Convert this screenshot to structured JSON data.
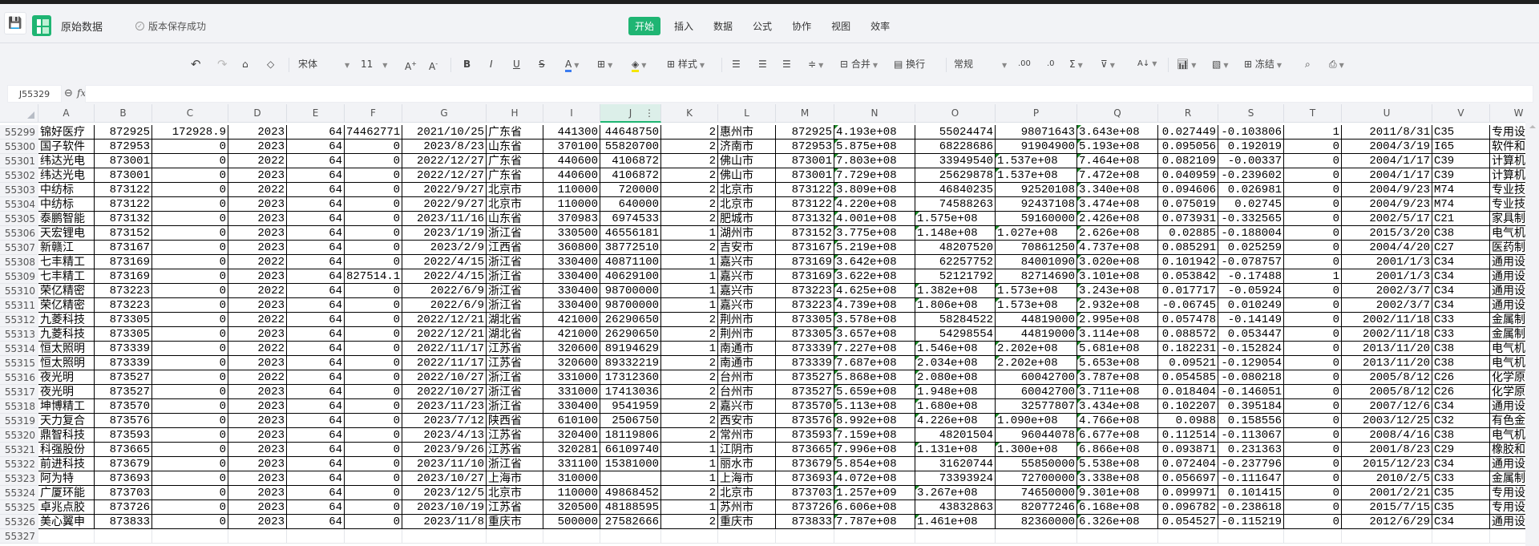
{
  "app": {
    "doc_title": "原始数据",
    "save_status": "版本保存成功",
    "brand_color": "#1fb573"
  },
  "menu_tabs": [
    {
      "label": "开始",
      "active": true
    },
    {
      "label": "插入",
      "active": false
    },
    {
      "label": "数据",
      "active": false
    },
    {
      "label": "公式",
      "active": false
    },
    {
      "label": "协作",
      "active": false
    },
    {
      "label": "视图",
      "active": false
    },
    {
      "label": "效率",
      "active": false
    }
  ],
  "toolbar": {
    "font_name": "宋体",
    "font_size": "11",
    "style_label": "样式",
    "merge_label": "合并",
    "wrap_label": "换行",
    "number_format": "常规",
    "freeze_label": "冻结",
    "font_color": "#3b7cf0",
    "fill_color": "#f5e600"
  },
  "formula_bar": {
    "name_box": "J55329",
    "formula": ""
  },
  "sheet": {
    "selected_column": "J",
    "columns": [
      "A",
      "B",
      "C",
      "D",
      "E",
      "F",
      "G",
      "H",
      "I",
      "J",
      "K",
      "L",
      "M",
      "N",
      "O",
      "P",
      "Q",
      "R",
      "S",
      "T",
      "U",
      "V",
      "W"
    ],
    "row_numbers": [
      "55299",
      "55300",
      "55301",
      "55302",
      "55303",
      "55304",
      "55305",
      "55306",
      "55307",
      "55308",
      "55309",
      "55310",
      "55311",
      "55312",
      "55313",
      "55314",
      "55315",
      "55316",
      "55317",
      "55318",
      "55319",
      "55320",
      "55321",
      "55322",
      "55323",
      "55324",
      "55325",
      "55326",
      "55327"
    ],
    "rows": [
      [
        "锦好医疗",
        "872925",
        "172928.9",
        "2023",
        "64",
        "74462771",
        "2021/10/25",
        "广东省",
        "441300",
        "44648750",
        "2",
        "惠州市",
        "872925",
        "4.193e+08",
        "55024474",
        "98071643",
        "3.643e+08",
        "0.027449",
        "-0.103806",
        "1",
        "2011/8/31",
        "C35",
        "专用设"
      ],
      [
        "国子软件",
        "872953",
        "0",
        "2023",
        "64",
        "0",
        "2023/8/23",
        "山东省",
        "370100",
        "55820700",
        "2",
        "济南市",
        "872953",
        "5.875e+08",
        "68228686",
        "91904900",
        "5.193e+08",
        "0.095056",
        "0.192019",
        "0",
        "2004/3/19",
        "I65",
        "软件和"
      ],
      [
        "纬达光电",
        "873001",
        "0",
        "2022",
        "64",
        "0",
        "2022/12/27",
        "广东省",
        "440600",
        "4106872",
        "2",
        "佛山市",
        "873001",
        "7.803e+08",
        "33949540",
        "1.537e+08",
        "7.464e+08",
        "0.082109",
        "-0.00337",
        "0",
        "2004/1/17",
        "C39",
        "计算机"
      ],
      [
        "纬达光电",
        "873001",
        "0",
        "2023",
        "64",
        "0",
        "2022/12/27",
        "广东省",
        "440600",
        "4106872",
        "2",
        "佛山市",
        "873001",
        "7.729e+08",
        "25629878",
        "1.537e+08",
        "7.472e+08",
        "0.040959",
        "-0.239602",
        "0",
        "2004/1/17",
        "C39",
        "计算机"
      ],
      [
        "中纺标",
        "873122",
        "0",
        "2022",
        "64",
        "0",
        "2022/9/27",
        "北京市",
        "110000",
        "720000",
        "2",
        "北京市",
        "873122",
        "3.809e+08",
        "46840235",
        "92520108",
        "3.340e+08",
        "0.094606",
        "0.026981",
        "0",
        "2004/9/23",
        "M74",
        "专业技"
      ],
      [
        "中纺标",
        "873122",
        "0",
        "2023",
        "64",
        "0",
        "2022/9/27",
        "北京市",
        "110000",
        "640000",
        "2",
        "北京市",
        "873122",
        "4.220e+08",
        "74588263",
        "92437108",
        "3.474e+08",
        "0.075019",
        "0.02745",
        "0",
        "2004/9/23",
        "M74",
        "专业技"
      ],
      [
        "泰鹏智能",
        "873132",
        "0",
        "2023",
        "64",
        "0",
        "2023/11/16",
        "山东省",
        "370983",
        "6974533",
        "2",
        "肥城市",
        "873132",
        "4.001e+08",
        "1.575e+08",
        "59160000",
        "2.426e+08",
        "0.073931",
        "-0.332565",
        "0",
        "2002/5/17",
        "C21",
        "家具制"
      ],
      [
        "天宏锂电",
        "873152",
        "0",
        "2023",
        "64",
        "0",
        "2023/1/19",
        "浙江省",
        "330500",
        "46556181",
        "1",
        "湖州市",
        "873152",
        "3.775e+08",
        "1.148e+08",
        "1.027e+08",
        "2.626e+08",
        "0.02885",
        "-0.188004",
        "0",
        "2015/3/20",
        "C38",
        "电气机"
      ],
      [
        "新赣江",
        "873167",
        "0",
        "2023",
        "64",
        "0",
        "2023/2/9",
        "江西省",
        "360800",
        "38772510",
        "2",
        "吉安市",
        "873167",
        "5.219e+08",
        "48207520",
        "70861250",
        "4.737e+08",
        "0.085291",
        "0.025259",
        "0",
        "2004/4/20",
        "C27",
        "医药制"
      ],
      [
        "七丰精工",
        "873169",
        "0",
        "2022",
        "64",
        "0",
        "2022/4/15",
        "浙江省",
        "330400",
        "40871100",
        "1",
        "嘉兴市",
        "873169",
        "3.642e+08",
        "62257752",
        "84001090",
        "3.020e+08",
        "0.101942",
        "-0.078757",
        "0",
        "2001/1/3",
        "C34",
        "通用设"
      ],
      [
        "七丰精工",
        "873169",
        "0",
        "2023",
        "64",
        "827514.1",
        "2022/4/15",
        "浙江省",
        "330400",
        "40629100",
        "1",
        "嘉兴市",
        "873169",
        "3.622e+08",
        "52121792",
        "82714690",
        "3.101e+08",
        "0.053842",
        "-0.17488",
        "1",
        "2001/1/3",
        "C34",
        "通用设"
      ],
      [
        "荣亿精密",
        "873223",
        "0",
        "2022",
        "64",
        "0",
        "2022/6/9",
        "浙江省",
        "330400",
        "98700000",
        "1",
        "嘉兴市",
        "873223",
        "4.625e+08",
        "1.382e+08",
        "1.573e+08",
        "3.243e+08",
        "0.017717",
        "-0.05924",
        "0",
        "2002/3/7",
        "C34",
        "通用设"
      ],
      [
        "荣亿精密",
        "873223",
        "0",
        "2023",
        "64",
        "0",
        "2022/6/9",
        "浙江省",
        "330400",
        "98700000",
        "1",
        "嘉兴市",
        "873223",
        "4.739e+08",
        "1.806e+08",
        "1.573e+08",
        "2.932e+08",
        "-0.06745",
        "0.010249",
        "0",
        "2002/3/7",
        "C34",
        "通用设"
      ],
      [
        "九菱科技",
        "873305",
        "0",
        "2022",
        "64",
        "0",
        "2022/12/21",
        "湖北省",
        "421000",
        "26290650",
        "2",
        "荆州市",
        "873305",
        "3.578e+08",
        "58284522",
        "44819000",
        "2.995e+08",
        "0.057478",
        "-0.14149",
        "0",
        "2002/11/18",
        "C33",
        "金属制"
      ],
      [
        "九菱科技",
        "873305",
        "0",
        "2023",
        "64",
        "0",
        "2022/12/21",
        "湖北省",
        "421000",
        "26290650",
        "2",
        "荆州市",
        "873305",
        "3.657e+08",
        "54298554",
        "44819000",
        "3.114e+08",
        "0.088572",
        "0.053447",
        "0",
        "2002/11/18",
        "C33",
        "金属制"
      ],
      [
        "恒太照明",
        "873339",
        "0",
        "2022",
        "64",
        "0",
        "2022/11/17",
        "江苏省",
        "320600",
        "89194629",
        "1",
        "南通市",
        "873339",
        "7.227e+08",
        "1.546e+08",
        "2.202e+08",
        "5.681e+08",
        "0.182231",
        "-0.152824",
        "0",
        "2013/11/20",
        "C38",
        "电气机"
      ],
      [
        "恒太照明",
        "873339",
        "0",
        "2023",
        "64",
        "0",
        "2022/11/17",
        "江苏省",
        "320600",
        "89332219",
        "2",
        "南通市",
        "873339",
        "7.687e+08",
        "2.034e+08",
        "2.202e+08",
        "5.653e+08",
        "0.09521",
        "-0.129054",
        "0",
        "2013/11/20",
        "C38",
        "电气机"
      ],
      [
        "夜光明",
        "873527",
        "0",
        "2022",
        "64",
        "0",
        "2022/10/27",
        "浙江省",
        "331000",
        "17312360",
        "2",
        "台州市",
        "873527",
        "5.868e+08",
        "2.080e+08",
        "60042700",
        "3.787e+08",
        "0.054585",
        "-0.080218",
        "0",
        "2005/8/12",
        "C26",
        "化学原"
      ],
      [
        "夜光明",
        "873527",
        "0",
        "2023",
        "64",
        "0",
        "2022/10/27",
        "浙江省",
        "331000",
        "17413036",
        "2",
        "台州市",
        "873527",
        "5.659e+08",
        "1.948e+08",
        "60042700",
        "3.711e+08",
        "0.018404",
        "-0.146051",
        "0",
        "2005/8/12",
        "C26",
        "化学原"
      ],
      [
        "坤博精工",
        "873570",
        "0",
        "2023",
        "64",
        "0",
        "2023/11/23",
        "浙江省",
        "330400",
        "9541959",
        "2",
        "嘉兴市",
        "873570",
        "5.113e+08",
        "1.680e+08",
        "32577807",
        "3.434e+08",
        "0.102207",
        "0.395184",
        "0",
        "2007/12/6",
        "C34",
        "通用设"
      ],
      [
        "天力复合",
        "873576",
        "0",
        "2023",
        "64",
        "0",
        "2023/7/12",
        "陕西省",
        "610100",
        "2506750",
        "2",
        "西安市",
        "873576",
        "8.992e+08",
        "4.226e+08",
        "1.090e+08",
        "4.766e+08",
        "0.0988",
        "0.158556",
        "0",
        "2003/12/25",
        "C32",
        "有色金"
      ],
      [
        "鼎智科技",
        "873593",
        "0",
        "2023",
        "64",
        "0",
        "2023/4/13",
        "江苏省",
        "320400",
        "18119806",
        "2",
        "常州市",
        "873593",
        "7.159e+08",
        "48201504",
        "96044078",
        "6.677e+08",
        "0.112514",
        "-0.113067",
        "0",
        "2008/4/16",
        "C38",
        "电气机"
      ],
      [
        "科强股份",
        "873665",
        "0",
        "2023",
        "64",
        "0",
        "2023/9/26",
        "江苏省",
        "320281",
        "66109740",
        "1",
        "江阴市",
        "873665",
        "7.996e+08",
        "1.131e+08",
        "1.300e+08",
        "6.866e+08",
        "0.093871",
        "0.231363",
        "0",
        "2001/8/23",
        "C29",
        "橡胶和"
      ],
      [
        "前进科技",
        "873679",
        "0",
        "2023",
        "64",
        "0",
        "2023/11/10",
        "浙江省",
        "331100",
        "15381000",
        "1",
        "丽水市",
        "873679",
        "5.854e+08",
        "31620744",
        "55850000",
        "5.538e+08",
        "0.072404",
        "-0.237796",
        "0",
        "2015/12/23",
        "C34",
        "通用设"
      ],
      [
        "阿为特",
        "873693",
        "0",
        "2023",
        "64",
        "0",
        "2023/10/27",
        "上海市",
        "310000",
        "",
        "1",
        "上海市",
        "873693",
        "4.072e+08",
        "73393924",
        "72700000",
        "3.338e+08",
        "0.056697",
        "-0.111647",
        "0",
        "2010/2/5",
        "C33",
        "金属制"
      ],
      [
        "广厦环能",
        "873703",
        "0",
        "2023",
        "64",
        "0",
        "2023/12/5",
        "北京市",
        "110000",
        "49868452",
        "2",
        "北京市",
        "873703",
        "1.257e+09",
        "3.267e+08",
        "74650000",
        "9.301e+08",
        "0.099971",
        "0.101415",
        "0",
        "2001/2/21",
        "C35",
        "专用设"
      ],
      [
        "卓兆点胶",
        "873726",
        "0",
        "2023",
        "64",
        "0",
        "2023/10/19",
        "江苏省",
        "320500",
        "48188595",
        "1",
        "苏州市",
        "873726",
        "6.606e+08",
        "43832863",
        "82077246",
        "6.168e+08",
        "0.096782",
        "-0.238618",
        "0",
        "2015/7/15",
        "C35",
        "专用设"
      ],
      [
        "美心翼申",
        "873833",
        "0",
        "2023",
        "64",
        "0",
        "2023/11/8",
        "重庆市",
        "500000",
        "27582666",
        "2",
        "重庆市",
        "873833",
        "7.787e+08",
        "1.461e+08",
        "82360000",
        "6.326e+08",
        "0.054527",
        "-0.115219",
        "0",
        "2012/6/29",
        "C34",
        "通用设"
      ]
    ]
  }
}
